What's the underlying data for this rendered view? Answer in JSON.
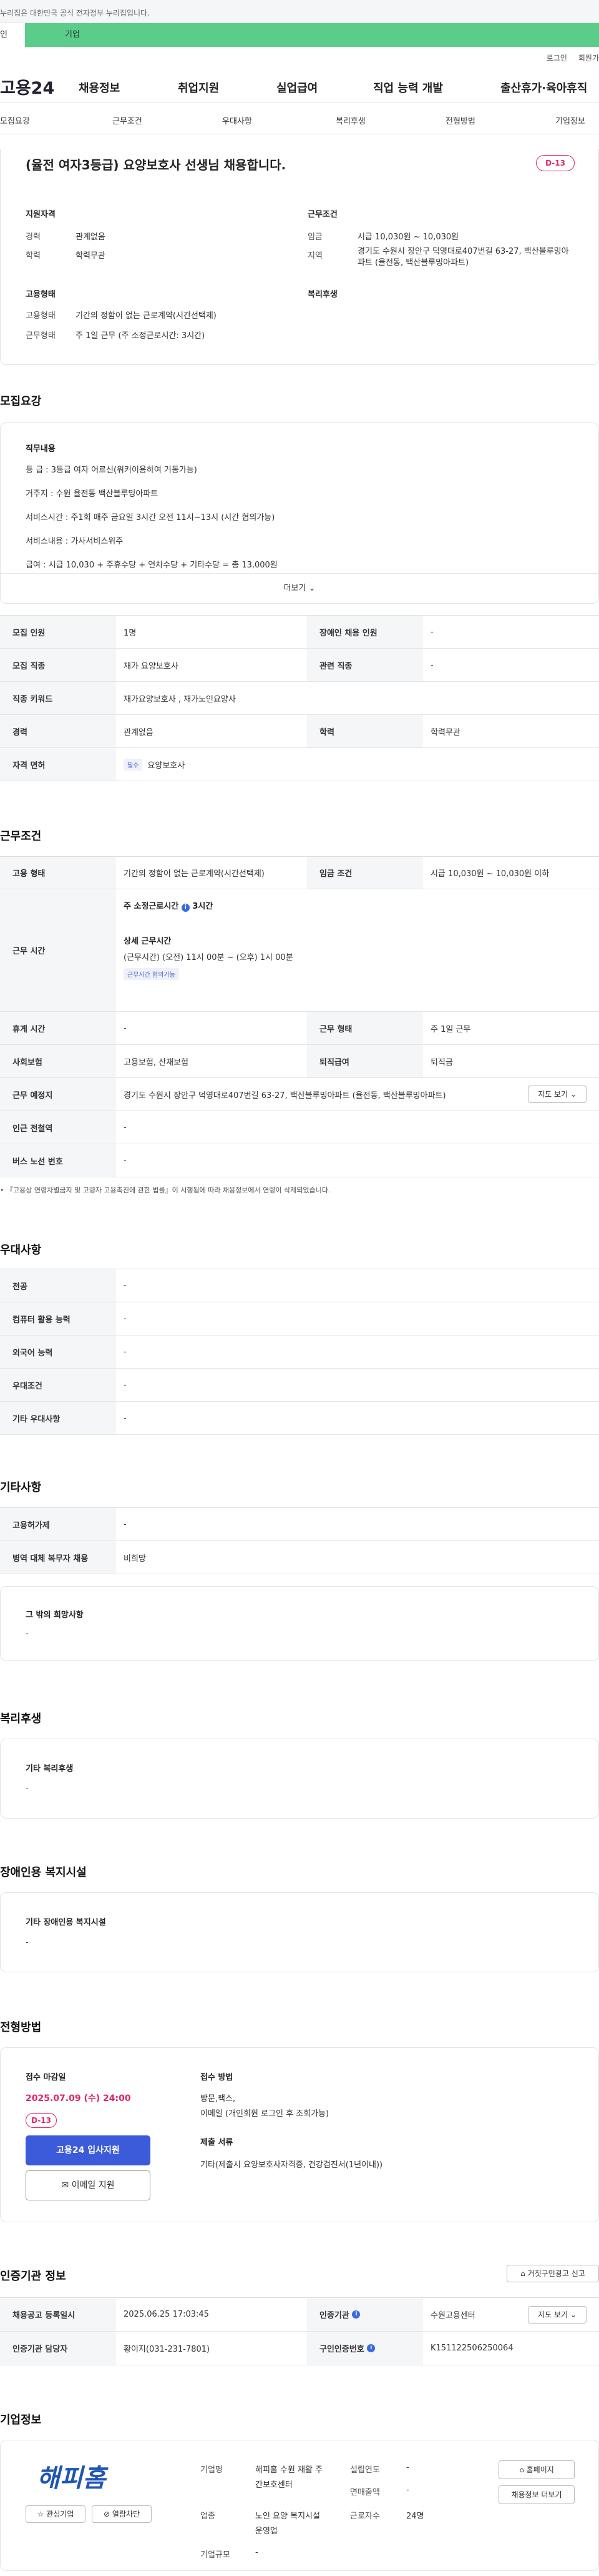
{
  "gov_banner": "누리집은 대한민국 공식 전자정부 누리집입니다.",
  "gnb": {
    "person": "인",
    "corp": "기업"
  },
  "util": {
    "login": "로그인",
    "join": "회원가"
  },
  "header": {
    "logo": "고용24",
    "nav": [
      "채용정보",
      "취업지원",
      "실업급여",
      "직업 능력 개발",
      "출산휴가·육아휴직"
    ]
  },
  "subnav": [
    "모집요강",
    "근무조건",
    "우대사항",
    "복리후생",
    "전형방법",
    "기업정보"
  ],
  "summary": {
    "title": "(율전 여자3등급) 요양보호사 선생님 채용합니다.",
    "dday": "D-13",
    "qual_title": "지원자격",
    "career_label": "경력",
    "career": "관계없음",
    "edu_label": "학력",
    "edu": "학력무관",
    "cond_title": "근무조건",
    "wage_label": "임금",
    "wage": "시급 10,030원 ~ 10,030원",
    "region_label": "지역",
    "region": "경기도 수원시 장안구 덕영대로407번길 63-27, 백산블루밍아파트 (율전동, 백산블루밍아파트)",
    "emp_title": "고용형태",
    "emp_label": "고용형태",
    "emp": "기간의 정함이 없는 근로계약(시간선택제)",
    "form_label": "근무형태",
    "form": "주 1일 근무 (주 소정근로시간: 3시간)",
    "welfare_title": "복리후생"
  },
  "recruit": {
    "title": "모집요강",
    "duty_title": "직무내용",
    "duty_lines": [
      "등    급 : 3등급 여자 어르신(워커이용하여 거동가능)",
      "거주지 : 수원 율전동 백산블루밍아파트",
      "서비스시간 : 주1회 매주 금요일 3시간 오전 11시~13시 (시간 협의가능)",
      "서비스내용 : 가사서비스위주",
      "급여 : 시급 10,030 + 주휴수당 + 연차수당 + 기타수당 = 총 13,000원"
    ],
    "more": "더보기",
    "rows": [
      [
        {
          "k": "모집 인원",
          "v": "1명"
        },
        {
          "k": "장애인 채용 인원",
          "v": "-"
        }
      ],
      [
        {
          "k": "모집 직종",
          "v": "재가 요양보호사"
        },
        {
          "k": "관련 직종",
          "v": "-"
        }
      ],
      [
        {
          "k": "직종 키워드",
          "v": "재가요양보호사 , 재가노인요양사"
        }
      ],
      [
        {
          "k": "경력",
          "v": "관계없음"
        },
        {
          "k": "학력",
          "v": "학력무관"
        }
      ],
      [
        {
          "k": "자격 면허",
          "v": "요양보호사",
          "tag": "필수"
        }
      ]
    ]
  },
  "work": {
    "title": "근무조건",
    "emp_label": "고용 형태",
    "emp": "기간의 정함이 없는 근로계약(시간선택제)",
    "wage_label": "임금 조건",
    "wage": "시급 10,030원 ~ 10,030원 이하",
    "time_label": "근무 시간",
    "weekly_label": "주 소정근로시간",
    "weekly": "3시간",
    "detail_label": "상세 근무시간",
    "detail": "(근무시간) (오전) 11시 00분 ~ (오후) 1시 00분",
    "detail_tag": "근무시간 협의가능",
    "holiday_label": "휴게 시간",
    "holiday": "-",
    "days_label": "근무 형태",
    "days": "주 1일 근무",
    "ins_label": "사회보험",
    "ins": "고용보험, 산재보험",
    "sev_label": "퇴직급여",
    "sev": "퇴직금",
    "place_label": "근무 예정지",
    "place": "경기도 수원시 장안구 덕영대로407번길 63-27, 백산블루밍아파트 (율전동, 백산블루밍아파트)",
    "map_btn": "지도 보기",
    "subway_label": "인근 전철역",
    "subway": "-",
    "bus_label": "버스 노선 번호",
    "bus": "-",
    "note": "『고용상 연령차별금지 및 고령자 고용촉진에 관한 법률』이 시행됨에 따라 채용정보에서 연령이 삭제되었습니다."
  },
  "pref": {
    "title": "우대사항",
    "rows": [
      {
        "k": "전공",
        "v": "-"
      },
      {
        "k": "컴퓨터 활용 능력",
        "v": "-"
      },
      {
        "k": "외국어 능력",
        "v": "-"
      },
      {
        "k": "우대조건",
        "v": "-"
      },
      {
        "k": "기타 우대사항",
        "v": "-"
      }
    ]
  },
  "etc": {
    "title": "기타사항",
    "rows": [
      {
        "k": "고용허가제",
        "v": "-"
      },
      {
        "k": "병역 대체 복무자 채용",
        "v": "비희망"
      }
    ],
    "wish_title": "그 밖의 희망사항",
    "wish": "-"
  },
  "welfare": {
    "title": "복리후생",
    "box_title": "기타 복리후생",
    "box": "-"
  },
  "disabled": {
    "title": "장애인용 복지시설",
    "box_title": "기타 장애인용 복지시설",
    "box": "-"
  },
  "apply": {
    "title": "전형방법",
    "deadline_label": "접수 마감일",
    "deadline": "2025.07.09 (수) 24:00",
    "dday": "D-13",
    "apply_btn": "고용24 입사지원",
    "email_btn": "이메일 지원",
    "method_label": "접수 방법",
    "method1": "방문,팩스,",
    "method2": "이메일 (개인회원 로그인 후 조회가능)",
    "docs_label": "제출 서류",
    "docs": "기타(제출시 요양보호사자격증, 건강검진서(1년이내))"
  },
  "cert": {
    "title": "인증기관 정보",
    "report_btn": "거짓구인광고 신고",
    "r1": [
      {
        "k": "채용공고 등록일시",
        "v": "2025.06.25 17:03:45"
      },
      {
        "k": "인증기관",
        "v": "수원고용센터"
      }
    ],
    "r2": [
      {
        "k": "인증기관 담당자",
        "v": "황이지(031-231-7801)"
      },
      {
        "k": "구인인증번호",
        "v": "K151122506250064"
      }
    ],
    "map_btn": "지도 보기"
  },
  "company": {
    "title": "기업정보",
    "logo_text": "해피홈",
    "fav_btn": "관심기업",
    "block_btn": "열람차단",
    "name_label": "기업명",
    "name": "해피홈 수원 재활 주간보호센터",
    "year_label": "설립연도",
    "year": "-",
    "sales_label": "연매출액",
    "sales": "-",
    "ind_label": "업종",
    "ind": "노인 요양 복지시설 운영업",
    "emp_label": "근로자수",
    "emp": "24명",
    "size_label": "기업규모",
    "size": "-",
    "home_btn": "홈페이지",
    "list_btn": "채용정보 더보기"
  }
}
